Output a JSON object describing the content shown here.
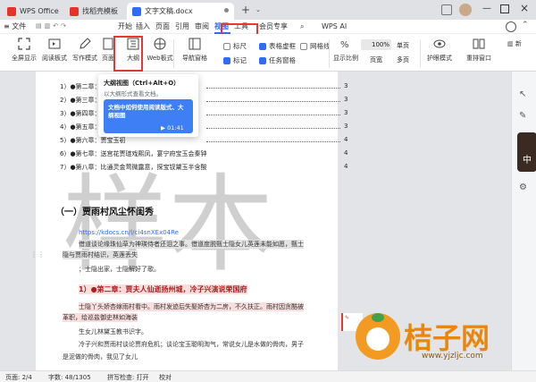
{
  "tabs": [
    {
      "label": "WPS Office"
    },
    {
      "label": "找稻壳模板"
    },
    {
      "label": "文字文稿.docx"
    }
  ],
  "menu": {
    "file": "≡ 文件",
    "items": [
      "开始",
      "插入",
      "页面",
      "引用",
      "审阅",
      "视图",
      "工具",
      "会员专享"
    ],
    "ai": "WPS AI"
  },
  "ribbon": {
    "buttons": [
      "全屏显示",
      "阅读板式",
      "写作模式",
      "页面",
      "大纲",
      "Web板式",
      "导航窗格"
    ],
    "checks": [
      {
        "label": "标尺",
        "on": false
      },
      {
        "label": "表格虚框",
        "on": true
      },
      {
        "label": "网格线",
        "on": false
      },
      {
        "label": "标记",
        "on": true
      },
      {
        "label": "任务窗格",
        "on": true
      }
    ],
    "zoom_label": "显示比例",
    "zoom": "100%",
    "single": "单页",
    "multi": "多页",
    "page_width": "页宽",
    "eye": "护眼模式",
    "rearrange": "重排窗口"
  },
  "toc": [
    {
      "text": "1）●第二章：贾夫人",
      "page": "3"
    },
    {
      "text": "2）●第三章：贾雨村",
      "page": "3"
    },
    {
      "text": "3）●第四章：薄命女",
      "page": "3"
    },
    {
      "text": "4）●第五章：贾宝玉",
      "page": "3"
    },
    {
      "text": "5）●第六章：贾宝玉初",
      "page": "4"
    },
    {
      "text": "6）●第七章：送宫花贾琏戏熙凤，宴宁府宝玉会秦钟",
      "page": "4"
    },
    {
      "text": "7）●第八章：比通灵金莺微露意，探宝钗黛玉半含酸",
      "page": "4"
    }
  ],
  "tooltip": {
    "title": "大纲视图（Ctrl+Alt+O）",
    "desc": "以大纲形式查看文档。",
    "card": "文档中如何使用阅读版式、大纲视图",
    "time": "01:41"
  },
  "watermark": "样本",
  "doc": {
    "heading": "（一）贾雨村风尘怀闺秀",
    "link": "https://kdocs.cn/l/ci4snXEx04Re",
    "p1": "借道谈论缘珠仙草为神瑛侍者还泪之事。借道度脱甄士隐女儿英莲未能如愿，甄士",
    "p2": "隐与贾雨村结识，英莲丢失",
    "p3": "；士隐出家，士隐解好了歌。",
    "h2": "1）●第二章：贾夫人仙逝扬州城，冷子兴演说荣国府",
    "p4": "士隐丫头娇杏嫁雨村看中。雨村发迹后失娶娇杏为二房，不久扶正。雨村因贪酷被",
    "p5": "革职，给巡盐御史林如海装",
    "p6": "生女儿林黛玉教书识字。",
    "p7": "冷子兴和贾雨村谈论贾府危机；谈论宝玉聪明淘气，常说女儿是水做的骨肉，男子",
    "p8": "是泥做的骨肉，我见了女儿"
  },
  "logo": {
    "text": "桔子网",
    "url": "www.yjzljc.com"
  },
  "status": {
    "page": "页面: 2/4",
    "words": "字数: 48/1305",
    "spell": "拼写检查: 打开",
    "proof": "校对"
  }
}
